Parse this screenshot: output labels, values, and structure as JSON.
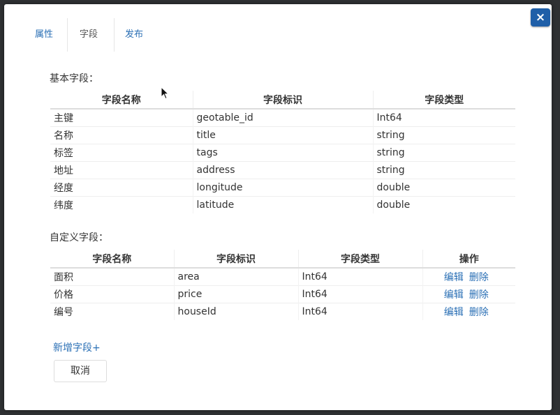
{
  "tabs": [
    {
      "label": "属性"
    },
    {
      "label": "字段"
    },
    {
      "label": "发布"
    }
  ],
  "close_label": "×",
  "basic": {
    "label": "基本字段：",
    "headers": [
      "字段名称",
      "字段标识",
      "字段类型"
    ],
    "rows": [
      {
        "name": "主键",
        "key": "geotable_id",
        "type": "Int64"
      },
      {
        "name": "名称",
        "key": "title",
        "type": "string"
      },
      {
        "name": "标签",
        "key": "tags",
        "type": "string"
      },
      {
        "name": "地址",
        "key": "address",
        "type": "string"
      },
      {
        "name": "经度",
        "key": "longitude",
        "type": "double"
      },
      {
        "name": "纬度",
        "key": "latitude",
        "type": "double"
      }
    ]
  },
  "custom": {
    "label": "自定义字段：",
    "headers": [
      "字段名称",
      "字段标识",
      "字段类型",
      "操作"
    ],
    "edit_label": "编辑",
    "delete_label": "删除",
    "rows": [
      {
        "name": "面积",
        "key": "area",
        "type": "Int64"
      },
      {
        "name": "价格",
        "key": "price",
        "type": "Int64"
      },
      {
        "name": "编号",
        "key": "houseId",
        "type": "Int64"
      }
    ]
  },
  "add_field_label": "新增字段+",
  "cancel_label": "取消"
}
